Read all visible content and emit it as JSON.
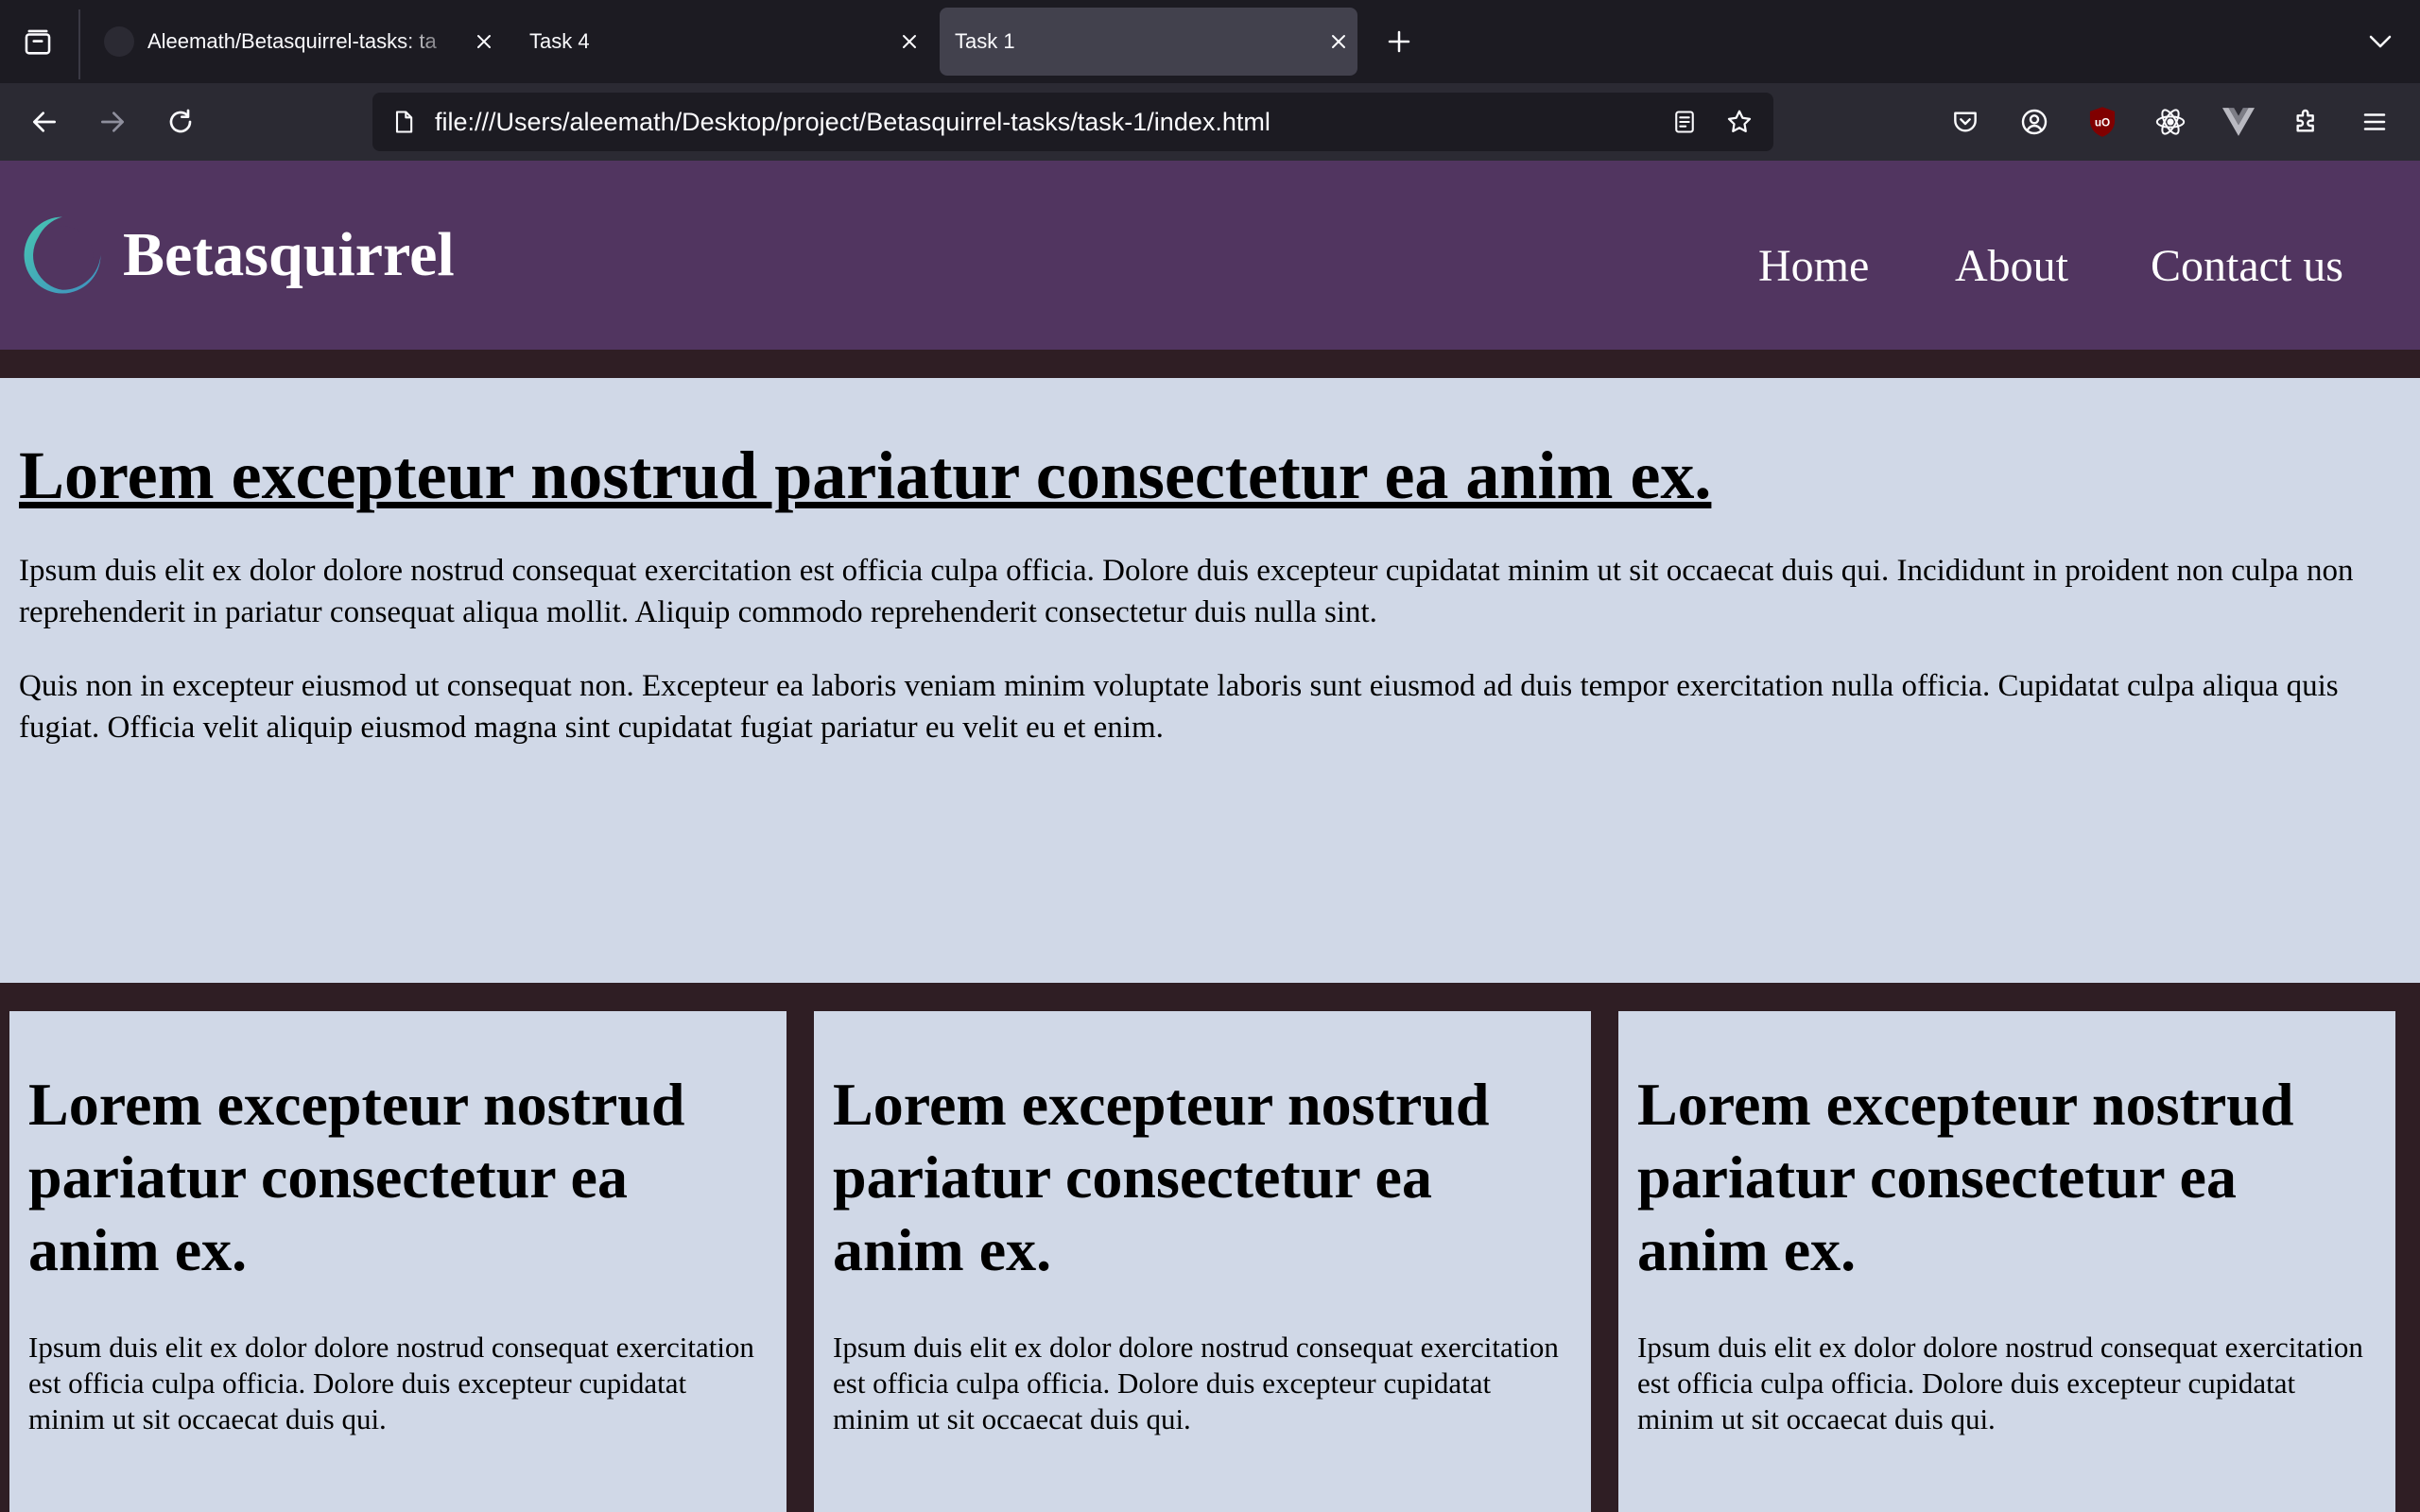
{
  "browser": {
    "tabs": [
      {
        "title": "Aleemath/Betasquirrel-tasks: ta",
        "has_favicon": true,
        "active": false
      },
      {
        "title": "Task 4",
        "has_favicon": false,
        "active": false
      },
      {
        "title": "Task 1",
        "has_favicon": false,
        "active": true
      }
    ],
    "url": "file:///Users/aleemath/Desktop/project/Betasquirrel-tasks/task-1/index.html",
    "icons": {
      "tab_list": "tab-list-icon",
      "new_tab": "plus-icon",
      "list_all_tabs": "chevron-down-icon",
      "back": "back-arrow-icon",
      "forward": "forward-arrow-icon",
      "reload": "reload-icon",
      "page_info": "page-icon",
      "reader": "reader-view-icon",
      "bookmark": "star-icon",
      "extensions": [
        "pocket-icon",
        "account-icon",
        "ublock-origin-icon",
        "react-devtools-icon",
        "vue-devtools-icon",
        "extensions-puzzle-icon",
        "menu-icon"
      ]
    }
  },
  "site": {
    "brand": "Betasquirrel",
    "nav": [
      "Home",
      "About",
      "Contact us"
    ],
    "hero": {
      "title": "Lorem excepteur nostrud pariatur consectetur ea anim ex.",
      "paragraphs": [
        "Ipsum duis elit ex dolor dolore nostrud consequat exercitation est officia culpa officia. Dolore duis excepteur cupidatat minim ut sit occaecat duis qui. Incididunt in proident non culpa non reprehenderit in pariatur consequat aliqua mollit. Aliquip commodo reprehenderit consectetur duis nulla sint.",
        "Quis non in excepteur eiusmod ut consequat non. Excepteur ea laboris veniam minim voluptate laboris sunt eiusmod ad duis tempor exercitation nulla officia. Cupidatat culpa aliqua quis fugiat. Officia velit aliquip eiusmod magna sint cupidatat fugiat pariatur eu velit eu et enim."
      ]
    },
    "cards": [
      {
        "title": "Lorem excepteur nostrud pariatur consectetur ea anim ex.",
        "text": "Ipsum duis elit ex dolor dolore nostrud consequat exercitation est officia culpa officia. Dolore duis excepteur cupidatat minim ut sit occaecat duis qui."
      },
      {
        "title": "Lorem excepteur nostrud pariatur consectetur ea anim ex.",
        "text": "Ipsum duis elit ex dolor dolore nostrud consequat exercitation est officia culpa officia. Dolore duis excepteur cupidatat minim ut sit occaecat duis qui."
      },
      {
        "title": "Lorem excepteur nostrud pariatur consectetur ea anim ex.",
        "text": "Ipsum duis elit ex dolor dolore nostrud consequat exercitation est officia culpa officia. Dolore duis excepteur cupidatat minim ut sit occaecat duis qui."
      }
    ]
  },
  "colors": {
    "chrome_dark": "#1c1b22",
    "toolbar": "#2b2a33",
    "active_tab": "#42414d",
    "header_bg": "#513560",
    "page_bg": "#2f1e24",
    "content_bg": "#d0d8e7",
    "logo_gradient": [
      "#47c6b1",
      "#3f8fbf"
    ]
  }
}
